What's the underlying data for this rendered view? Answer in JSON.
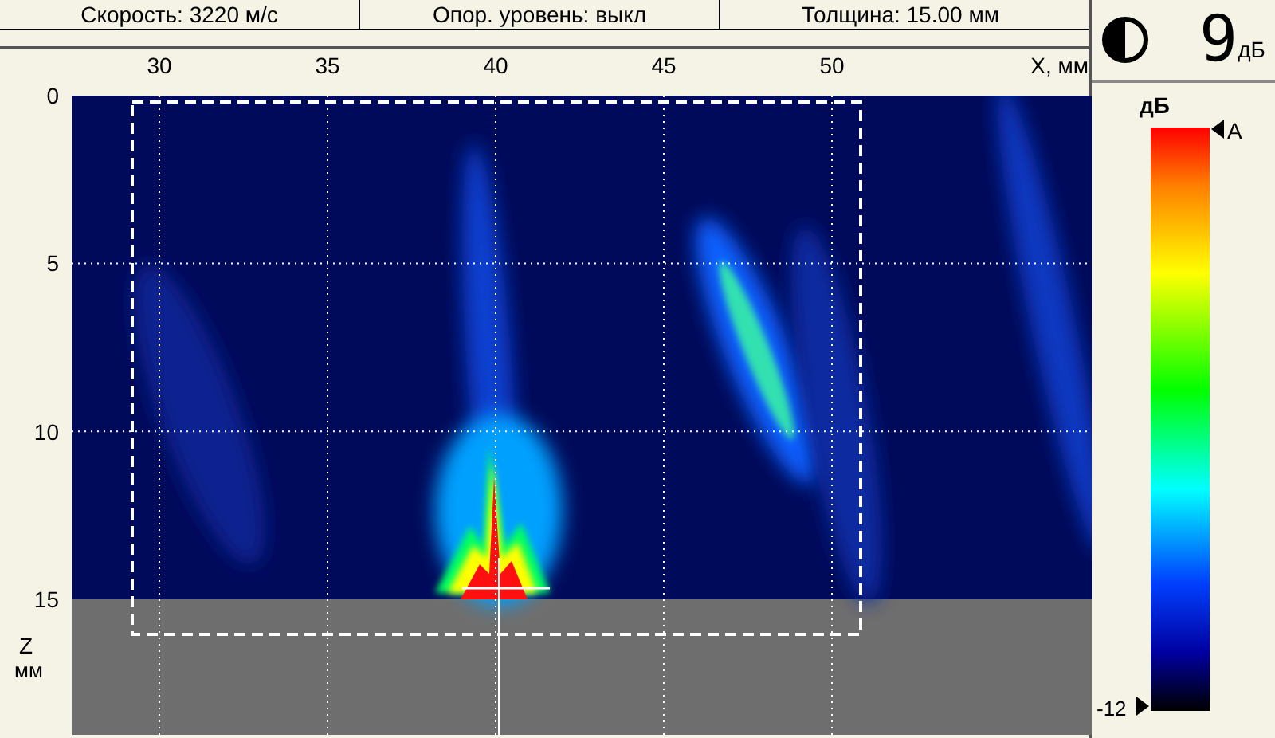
{
  "status_bar": [
    {
      "text": "Скорость: 3220 м/с"
    },
    {
      "text": "Опор. уровень: выкл"
    },
    {
      "text": "Толщина: 15.00 мм"
    }
  ],
  "gain": {
    "value": "9",
    "unit": "дБ"
  },
  "plot": {
    "x_ticks": [
      "30",
      "35",
      "40",
      "45",
      "50"
    ],
    "x_label": "X, мм",
    "z_ticks": [
      "0",
      "5",
      "10",
      "15"
    ],
    "z_label": "Z",
    "z_unit": "мм",
    "kind": "picture"
  },
  "color_scale": {
    "title": "дБ",
    "marker": "A",
    "bottom_label": "-12"
  }
}
